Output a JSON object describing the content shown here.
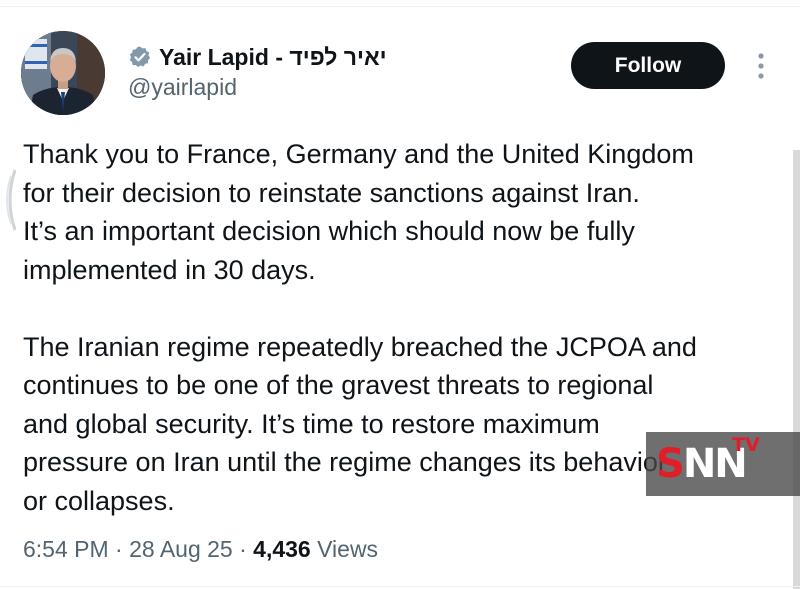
{
  "tweet": {
    "author": {
      "display_name": "Yair Lapid - יאיר לפיד",
      "handle": "@yairlapid",
      "verified": true
    },
    "follow_label": "Follow",
    "paragraphs": [
      "Thank you to France, Germany and the United Kingdom\nfor their decision to reinstate sanctions against Iran.\nIt’s an important decision which should now be fully\nimplemented in 30 days.",
      "The Iranian regime repeatedly breached the JCPOA and\ncontinues to be one of the gravest threats to regional\nand global security. It’s time to restore maximum\npressure on Iran until the regime changes its behavior\nor collapses."
    ],
    "time": "6:54 PM",
    "separator": "·",
    "date": "28 Aug 25",
    "views_count": "4,436",
    "views_label": "Views"
  },
  "watermark": {
    "brand_s": "S",
    "brand_nn": "NN",
    "brand_tv": "TV"
  },
  "icons": {
    "verified": "verified-badge-icon",
    "more": "more-vertical-icon",
    "avatar": "profile-photo"
  },
  "colors": {
    "text": "#0f1419",
    "secondary": "#536471",
    "follow_bg": "#0f1419",
    "verified_badge": "#829aab",
    "watermark_red": "#e11d2a"
  }
}
